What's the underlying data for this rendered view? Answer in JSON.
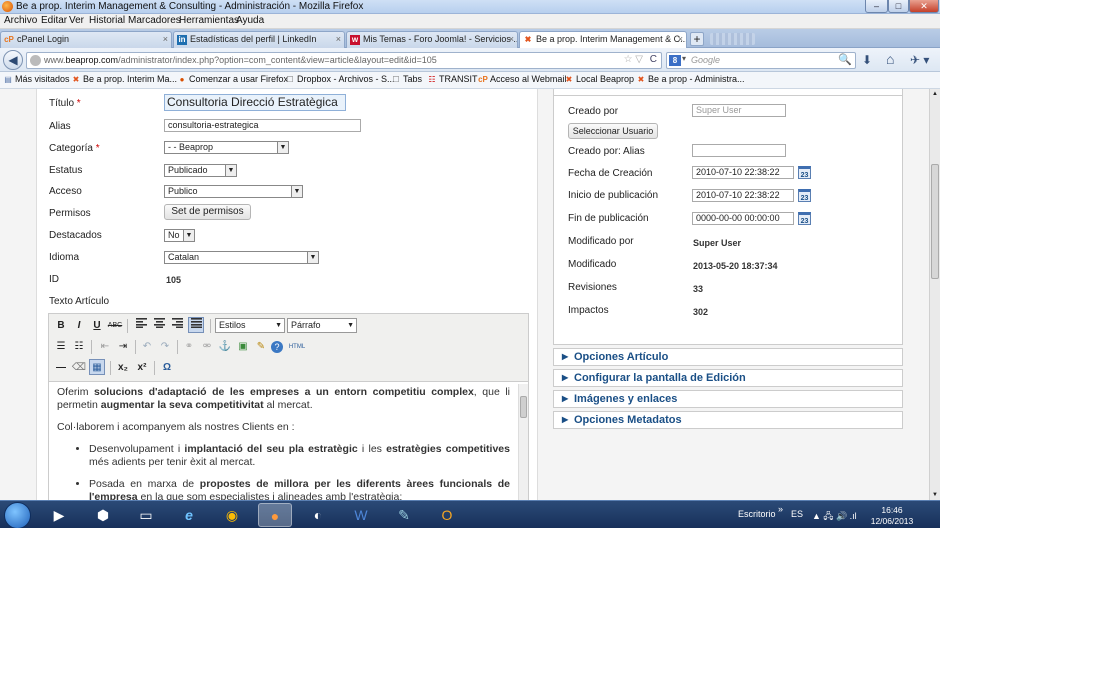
{
  "window": {
    "title": "Be a prop. Interim Management & Consulting - Administración - Mozilla Firefox",
    "controls": {
      "minimize": "–",
      "maximize": "□",
      "close": "✕"
    }
  },
  "menu": [
    "Archivo",
    "Editar",
    "Ver",
    "Historial",
    "Marcadores",
    "Herramientas",
    "Ayuda"
  ],
  "tabs": [
    {
      "label": "cPanel Login",
      "icon": "cpanel-icon"
    },
    {
      "label": "Estadísticas del perfil | LinkedIn",
      "icon": "linkedin-icon"
    },
    {
      "label": "Mis Temas - Foro Joomla! - Servicios ...",
      "icon": "joomla-forum-icon"
    },
    {
      "label": "Be a prop. Interim Management & C...",
      "icon": "joomla-icon",
      "active": true
    }
  ],
  "tab_close": "×",
  "tab_new": "+",
  "nav": {
    "url_prefix": "www.",
    "url_domain": "beaprop.com",
    "url_path": "/administrator/index.php?option=com_content&view=article&layout=edit&id=105",
    "star": "☆ ▽",
    "reload": "C",
    "search_engine": "8",
    "search_dropdown": "▾",
    "search_placeholder": "Google",
    "search_glass": "🔍",
    "back": "◀",
    "download": "⬇",
    "home": "⌂",
    "tools": "✈ ▾"
  },
  "bookmarks": [
    "Más visitados",
    "Be a prop. Interim Ma...",
    "Comenzar a usar Firefox",
    "Dropbox - Archivos - S...",
    "Tabs",
    "TRANSIT",
    "Acceso al Webmail",
    "Local Beaprop",
    "Be a prop - Administra..."
  ],
  "form": {
    "titulo_label": "Título",
    "required": "*",
    "titulo_value": "Consultoria Direcció Estratègica",
    "alias_label": "Alias",
    "alias_value": "consultoria-estrategica",
    "categoria_label": "Categoría",
    "categoria_value": "- - Beaprop",
    "estatus_label": "Estatus",
    "estatus_value": "Publicado",
    "acceso_label": "Acceso",
    "acceso_value": "Publico",
    "permisos_label": "Permisos",
    "permisos_button": "Set de permisos",
    "destacados_label": "Destacados",
    "destacados_value": "No",
    "idioma_label": "Idioma",
    "idioma_value": "Catalan",
    "id_label": "ID",
    "id_value": "105",
    "texto_label": "Texto Artículo",
    "select_arrow": "▼"
  },
  "editor": {
    "toolbar_row1": [
      "B",
      "I",
      "U",
      "ABC"
    ],
    "estilos": "Estilos",
    "parrafo": "Párrafo",
    "html_label": "HTML",
    "subscript": "x₂",
    "superscript": "x²",
    "omega": "Ω",
    "icons": {
      "bullet_list": "☰",
      "numbered_list": "☷",
      "outdent": "⇤",
      "indent": "⇥",
      "undo": "↶",
      "redo": "↷",
      "link": "⚭",
      "unlink": "⚮",
      "anchor": "⚓",
      "image": "▣",
      "cleanup": "✎",
      "help": "?",
      "hr": "—",
      "eraser": "⌫",
      "table": "▦"
    },
    "content": {
      "p1_a": "Oferim ",
      "p1_b": "solucions d'adaptació de les empreses a un entorn competitiu complex",
      "p1_c": ", que li permetin ",
      "p1_d": "augmentar la seva competitivitat",
      "p1_e": " al mercat.",
      "p2": "Col·laborem i acompanyem als nostres Clients en :",
      "li1_a": "Desenvolupament i ",
      "li1_b": "implantació del seu pla estratègic",
      "li1_c": " i les ",
      "li1_d": "estratègies competitives",
      "li1_e": " més adients per tenir èxit al mercat.",
      "li2_a": "Posada en marxa de ",
      "li2_b": "propostes de millora per les diferents àrees funcionals de l'empresa",
      "li2_c": " en la que som especialistes i alineades amb l'estratègia:"
    }
  },
  "publishing": {
    "creado_por_label": "Creado por",
    "creado_por_placeholder": "Super User",
    "select_user_button": "Seleccionar Usuario",
    "creado_alias_label": "Creado por: Alias",
    "fecha_creacion_label": "Fecha de Creación",
    "fecha_creacion_value": "2010-07-10 22:38:22",
    "inicio_label": "Inicio de publicación",
    "inicio_value": "2010-07-10 22:38:22",
    "fin_label": "Fin de publicación",
    "fin_value": "0000-00-00 00:00:00",
    "calendar_day": "23",
    "modificado_por_label": "Modificado por",
    "modificado_por_value": "Super User",
    "modificado_label": "Modificado",
    "modificado_value": "2013-05-20 18:37:34",
    "revisiones_label": "Revisiones",
    "revisiones_value": "33",
    "impactos_label": "Impactos",
    "impactos_value": "302"
  },
  "accordions": [
    "Opciones Artículo",
    "Configurar la pantalla de Edición",
    "Imágenes y enlaces",
    "Opciones Metadatos"
  ],
  "accordion_arrow": "▶",
  "taskbar": {
    "desktop_label": "Escritorio",
    "chevron": "»",
    "lang": "ES",
    "tray_icons": "▲ 🖧 🔊 .ıl",
    "time": "16:46",
    "date": "12/06/2013"
  }
}
